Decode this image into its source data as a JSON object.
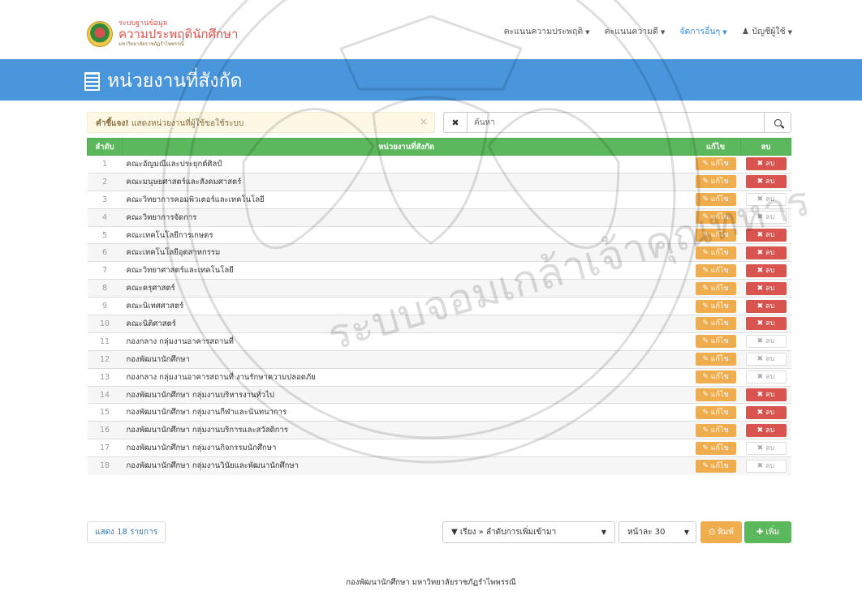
{
  "navbar": {
    "brand_line1": "ระบบฐานข้อมูล",
    "brand_line2": "ความประพฤตินักศึกษา",
    "brand_line3": "มหาวิทยาลัยราชภัฏรำไพพรรณี",
    "menu": [
      {
        "label": "คะแนนความประพฤติ",
        "active": false
      },
      {
        "label": "คะแนนความดี",
        "active": false
      },
      {
        "label": "จัดการอื่นๆ",
        "active": true
      },
      {
        "label": "บัญชีผู้ใช้",
        "active": false
      }
    ],
    "user_icon": "user-icon",
    "accent_color": "#3a8ed8"
  },
  "banner": {
    "title": "หน่วยงานที่สังกัด",
    "icon": "building-icon",
    "color": "#4a96dc"
  },
  "alert": {
    "bold": "คำชี้แจง!",
    "text": " แสดงหน่วยงานที่ผู้ใช้ขอใช้ระบบ",
    "close": "×"
  },
  "search": {
    "clear": "✖",
    "placeholder": "ค้นหา"
  },
  "table": {
    "headers": {
      "num": "ลำดับ",
      "name": "หน่วยงานที่สังกัด",
      "edit": "แก้ไข",
      "del": "ลบ"
    },
    "edit_label": "แก้ไข",
    "del_label": "ลบ",
    "rows": [
      {
        "num": "1",
        "name": "คณะอัญมณีและประยุกต์ศิลป์",
        "deletable": true
      },
      {
        "num": "2",
        "name": "คณะมนุษยศาสตร์และสังคมศาสตร์",
        "deletable": true
      },
      {
        "num": "3",
        "name": "คณะวิทยาการคอมพิวเตอร์และเทคโนโลยี",
        "deletable": false
      },
      {
        "num": "4",
        "name": "คณะวิทยาการจัดการ",
        "deletable": false
      },
      {
        "num": "5",
        "name": "คณะเทคโนโลยีการเกษตร",
        "deletable": true
      },
      {
        "num": "6",
        "name": "คณะเทคโนโลยีอุตสาหกรรม",
        "deletable": true
      },
      {
        "num": "7",
        "name": "คณะวิทยาศาสตร์และเทคโนโลยี",
        "deletable": true
      },
      {
        "num": "8",
        "name": "คณะครุศาสตร์",
        "deletable": true
      },
      {
        "num": "9",
        "name": "คณะนิเทศศาสตร์",
        "deletable": true
      },
      {
        "num": "10",
        "name": "คณะนิติศาสตร์",
        "deletable": true
      },
      {
        "num": "11",
        "name": "กองกลาง กลุ่มงานอาคารสถานที่",
        "deletable": false
      },
      {
        "num": "12",
        "name": "กองพัฒนานักศึกษา",
        "deletable": false
      },
      {
        "num": "13",
        "name": "กองกลาง กลุ่มงานอาคารสถานที่ งานรักษาความปลอดภัย",
        "deletable": false
      },
      {
        "num": "14",
        "name": "กองพัฒนานักศึกษา กลุ่มงานบริหารงานทั่วไป",
        "deletable": true
      },
      {
        "num": "15",
        "name": "กองพัฒนานักศึกษา กลุ่มงานกีฬาและนันทนาการ",
        "deletable": true
      },
      {
        "num": "16",
        "name": "กองพัฒนานักศึกษา กลุ่มงานบริการและสวัสดิการ",
        "deletable": true
      },
      {
        "num": "17",
        "name": "กองพัฒนานักศึกษา กลุ่มงานกิจกรรมนักศึกษา",
        "deletable": false
      },
      {
        "num": "18",
        "name": "กองพัฒนานักศึกษา กลุ่มงานวินัยและพัฒนานักศึกษา",
        "deletable": false
      }
    ]
  },
  "toolbar": {
    "count_prefix": "แสดง",
    "count": "18",
    "count_suffix": "รายการ",
    "sort_label": "▼ เรียง » ลำดับการเพิ่มเข้ามา",
    "per_page_label": "หน้าละ 30",
    "print_label": "พิมพ์",
    "add_label": "เพิ่ม"
  },
  "footer": {
    "text": "กองพัฒนานักศึกษา มหาวิทยาลัยราชภัฏรำไพพรรณี"
  },
  "watermark": {
    "text": "ระบบจอมเกล้าเจ้าคุณทหาร"
  },
  "colors": {
    "success": "#5cb85c",
    "warning": "#f0ad4e",
    "danger": "#d9534f"
  }
}
